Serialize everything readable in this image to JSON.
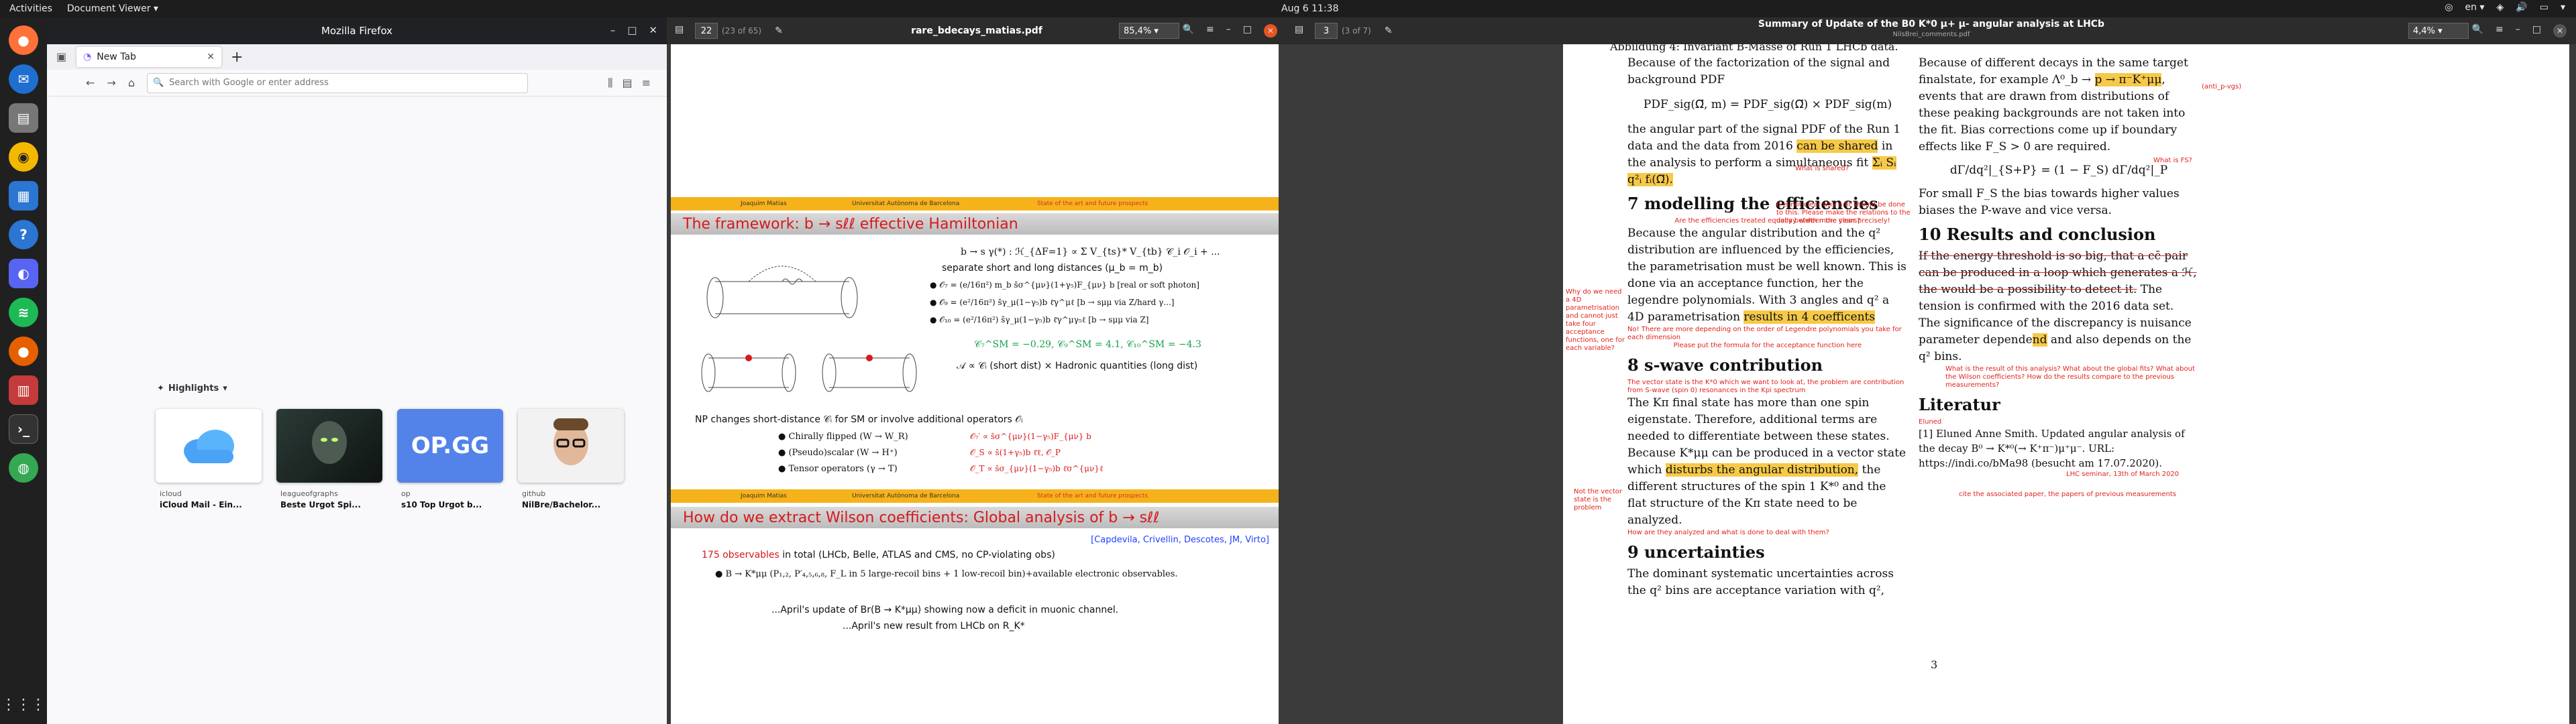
{
  "topbar": {
    "activities": "Activities",
    "app_menu": "Document Viewer ▾",
    "clock": "Aug 6  11:38",
    "lang": "en ▾"
  },
  "dock": {
    "apps": [
      "firefox-icon",
      "thunderbird-icon",
      "files-icon",
      "rhythmbox-icon",
      "writer-icon",
      "help-icon",
      "discord-icon",
      "spotify-icon",
      "firefox-dev-icon",
      "document-viewer-icon",
      "terminal-icon",
      "chrome-icon"
    ]
  },
  "firefox": {
    "title": "Mozilla Firefox",
    "tab_label": "New Tab",
    "search_placeholder": "Search with Google or enter address",
    "highlights_label": "Highlights",
    "tiles": [
      {
        "host": "icloud",
        "name": "iCloud Mail - Ein..."
      },
      {
        "host": "leagueofgraphs",
        "name": "Beste Urgot Spi..."
      },
      {
        "host": "op",
        "name": "s10 Top Urgot b..."
      },
      {
        "host": "github",
        "name": "NilBre/Bachelor..."
      }
    ],
    "opgg_logo": "OP.GG"
  },
  "viewer1": {
    "page": "22",
    "page_of": "(23 of 65)",
    "filename": "rare_bdecays_matias.pdf",
    "zoom": "85,4% ▾",
    "bar_left": "Joaquim Matias",
    "bar_mid": "Universitat Autònoma de Barcelona",
    "bar_right": "State of the art and future prospects",
    "slide1_title": "The framework: b → sℓℓ effective Hamiltonian",
    "heff": "b → s γ(*) : ℋ_{ΔF=1} ∝ Σ V_{ts}* V_{tb} 𝒞_i 𝒪_i + ...",
    "separate": "separate short and long distances (μ_b = m_b)",
    "ops": [
      "𝒪₇ = (e/16π²) m_b s̄σ^{μν}(1+γ₅)F_{μν} b      [real or soft photon]",
      "𝒪₉ = (e²/16π²) s̄γ_μ(1−γ₅)b ℓ̄γ^μℓ   [b → sμμ via Z/hard γ...]",
      "𝒪₁₀ = (e²/16π²) s̄γ_μ(1−γ₅)b ℓ̄γ^μγ₅ℓ    [b → sμμ via Z]"
    ],
    "sm_values": "𝒞₇^SM = −0.29,  𝒞₉^SM = 4.1,  𝒞₁₀^SM = −4.3",
    "factorization": "𝒜 ∝ 𝒞ᵢ (short dist) × Hadronic quantities (long dist)",
    "np_line": "NP changes short-distance 𝒞ᵢ for SM or involve additional operators 𝒪ᵢ",
    "np_items": [
      {
        "label": "Chirally flipped (W → W_R)",
        "op": "𝒪₇′ ∝ s̄σ^{μν}(1−γ₅)F_{μν} b"
      },
      {
        "label": "(Pseudo)scalar (W → H⁺)",
        "op": "𝒪_S ∝ s̄(1+γ₅)b ℓ̄ℓ, 𝒪_P"
      },
      {
        "label": "Tensor operators (γ → T)",
        "op": "𝒪_T ∝ s̄σ_{μν}(1−γ₅)b ℓ̄σ^{μν}ℓ"
      }
    ],
    "slide2_title": "How do we extract Wilson coefficients: Global analysis of b → sℓℓ",
    "refs": "[Capdevila, Crivellin, Descotes, JM, Virto]",
    "obs_count": "175 observables",
    "obs_rest": " in total (LHCb, Belle, ATLAS and CMS, no CP-violating obs)",
    "obs_item": "B → K*μμ (P₁,₂, P′₄,₅,₆,₈, F_L in 5 large-recoil bins + 1 low-recoil bin)+available electronic observables.",
    "april1": "...April's update of Br(B → K*μμ) showing now a deficit in muonic channel.",
    "april2": "...April's new result from LHCb on R_K*"
  },
  "viewer2": {
    "page": "3",
    "page_of": "(3 of 7)",
    "title": "Summary of Update of the B0 K*0 μ+ μ- angular analysis at LHCb",
    "subtitle": "NilsBrei_comments.pdf",
    "zoom": "4,4% ▾",
    "top_cut": "Abbildung 4: Invariant B-Masse of Run 1 LHCb data.",
    "p1": "Because of the factorization of the signal and background PDF",
    "formula1": "PDF_sig(Ω⃗, m) = PDF_sig(Ω⃗) × PDF_sig(m)",
    "p2a": "the angular part of the signal PDF of the Run 1 data and the data from 2016 ",
    "p2_hl": "can be shared",
    "p2b": " in the analysis to perform a simultaneous fit",
    "p2_formula": "Σᵢ Sᵢ q²ᵢ fᵢ(Ω⃗).",
    "note_shared": "What is shared?",
    "note_clear": "It is not clear why a fit should be done to this. Please make the relations to the decay width more clear precisely!",
    "h7": "7   modelling the efficiencies",
    "note_eff": "Are the efficiencies treated equally between the years?",
    "p7": "Because the angular distribution and the q² distribution are influenced by the efficiencies, the parametrisation must be well known. This is done via an acceptance function, her the legendre polynomials. With 3 angles and q² a 4D parametrisation ",
    "p7_hl": "results in 4 coefficents",
    "note_why": "Why do we need a 4D parametrisation and cannot just take four acceptance functions, one for each variable?",
    "note_more": "No! There are more depending on the order of Legendre polynomials you take for each dimension",
    "note_formula": "Please put the formula for the acceptance function here",
    "h8": "8   s-wave contribution",
    "note_vector": "The vector state is the K*0 which we want to look at, the problem are contribution from S-wave (spin 0) resonances in the Kpi spectrum",
    "note_notvector": "Not the vector state is the problem",
    "p8a": "The Kπ final state has more than one spin eigenstate. Therefore, additional terms are needed to differentiate between these states. Because K*μμ can be produced in a vector state which ",
    "p8_hl": "disturbs the angular distribution,",
    "p8b": " the different structures of the spin 1 K*⁰ and the flat structure of the Kπ state need to be analyzed.",
    "note_how": "How are they analyzed and what is done to deal with them?",
    "h9": "9   uncertainties",
    "p9": "The dominant systematic uncertainties across the q² bins are acceptance variation with q²,",
    "r1": "Because of different decays in the same target finalstate, for example Λ⁰_b → ",
    "r1_hl": "p → π⁻K⁺μμ",
    "r1b": ", events that are drawn from distributions of these peaking backgrounds are not taken into the fit. Bias corrections come up if boundary effects like F_S > 0 are required.",
    "note_antip": "(anti_p-vgs)",
    "note_fs": "What is FS?",
    "formula2": "dΓ/dq²|_{S+P} = (1 − F_S) dΓ/dq²|_P",
    "r2": "For small F_S the bias towards higher values biases the P-wave and vice versa.",
    "h10": "10   Results and conclusion",
    "r3_strike": "If the energy threshold is so big, that a cc̄ pair can be produced in a loop which generates a ℋ, the would be a possibility to detect it.",
    "r3": " The tension is confirmed with the 2016 data set. The significance of the discrepancy is nuisance parameter depende",
    "r3_hl": "nd",
    "r3b": " and also depends on the q² bins.",
    "note_result": "What is the result of this analysis? What about the global fits? What about the Wilson coefficients? How do the results compare to the previous measurements?",
    "lit": "Literatur",
    "note_eluned": "Eluned",
    "ref1": "[1]  Eluned Anne Smith. Updated angular analysis of the decay B⁰ → K*⁰(→ K⁺π⁻)μ⁺μ⁻. URL: https://indi.co/bMa98 (besucht am 17.07.2020).",
    "note_seminar": "LHC seminar, 13th of March 2020",
    "note_cite": "cite the associated paper, the papers of previous measurements",
    "page_number": "3"
  }
}
